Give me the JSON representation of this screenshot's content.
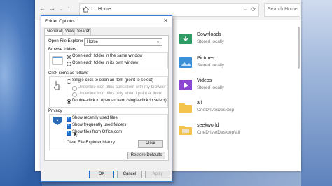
{
  "explorer": {
    "nav": {
      "back": "←",
      "forward": "→",
      "up": "↑",
      "refresh": "⟳"
    },
    "address": {
      "crumb": "Home"
    },
    "search": {
      "placeholder": "Search Home"
    },
    "items": [
      {
        "name": "Downloads",
        "sub": "Stored locally",
        "icon": "downloads-folder-icon",
        "color": "#2f9a63"
      },
      {
        "name": "Pictures",
        "sub": "Stored locally",
        "icon": "pictures-folder-icon",
        "color": "#3b8fd9"
      },
      {
        "name": "Videos",
        "sub": "Stored locally",
        "icon": "videos-folder-icon",
        "color": "#8b47d1"
      },
      {
        "name": "all",
        "sub": "OneDrive\\Desktop",
        "icon": "folder-icon",
        "color": "#f3c34d"
      },
      {
        "name": "seekworld",
        "sub": "OneDrive\\Desktop\\all",
        "icon": "folder-icon",
        "color": "#f3c34d"
      }
    ]
  },
  "dialog": {
    "title": "Folder Options",
    "close": "✕",
    "tabs": [
      "General",
      "View",
      "Search"
    ],
    "open_label": "Open File Explorer to:",
    "open_value": "Home",
    "browse": {
      "title": "Browse folders",
      "options": [
        "Open each folder in the same window",
        "Open each folder in its own window"
      ]
    },
    "click": {
      "title": "Click items as follows",
      "options": [
        "Single-click to open an item (point to select)",
        "Underline icon titles consistent with my browser",
        "Underline icon titles only when I point at them",
        "Double-click to open an item (single-click to select)"
      ]
    },
    "privacy": {
      "title": "Privacy",
      "options": [
        "Show recently used files",
        "Show frequently used folders",
        "Show files from Office.com"
      ],
      "clear_label": "Clear File Explorer history",
      "clear_button": "Clear"
    },
    "restore": "Restore Defaults",
    "ok": "OK",
    "cancel": "Cancel",
    "apply": "Apply"
  }
}
